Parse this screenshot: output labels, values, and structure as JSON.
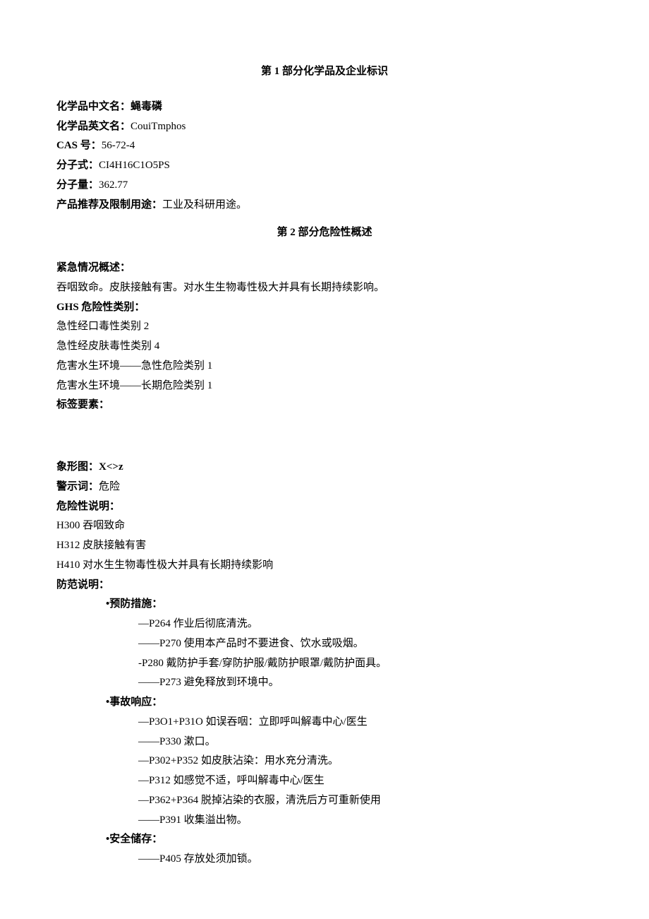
{
  "section1": {
    "title": "第 1 部分化学品及企业标识",
    "name_cn_label": "化学品中文名：",
    "name_cn_value": "蝇毒磷",
    "name_en_label": "化学品英文名：",
    "name_en_value": "CouiTmphos",
    "cas_label": "CAS 号：",
    "cas_value": "56-72-4",
    "formula_label": "分子式：",
    "formula_value": "CI4H16C1O5PS",
    "mw_label": "分子量：",
    "mw_value": "362.77",
    "use_label": "产品推荐及限制用途：",
    "use_value": "工业及科研用途。"
  },
  "section2": {
    "title": "第 2 部分危险性概述",
    "emergency_label": "紧急情况概述：",
    "emergency_value": "吞咽致命。皮肤接触有害。对水生生物毒性极大并具有长期持续影响。",
    "ghs_label": "GHS 危险性类别：",
    "ghs_items": [
      "急性经口毒性类别 2",
      "急性经皮肤毒性类别 4",
      "危害水生环境——急性危险类别 1",
      "危害水生环境——长期危险类别 1"
    ],
    "label_elements": "标签要素：",
    "pictogram_label": "象形图：",
    "pictogram_value": "X<>z",
    "signal_label": "警示词：",
    "signal_value": "危险",
    "hazard_label": "危险性说明：",
    "hazard_items": [
      "H300 吞咽致命",
      "H312 皮肤接触有害",
      "H410 对水生生物毒性极大并具有长期持续影响"
    ],
    "precaution_label": "防范说明：",
    "prevention_label": "•预防措施：",
    "prevention_items": [
      "—P264 作业后彻底清洗。",
      "——P270 使用本产品时不要进食、饮水或吸烟。",
      "-P280 戴防护手套/穿防护服/戴防护眼罩/戴防护面具。",
      "——P273 避免释放到环境中。"
    ],
    "response_label": "•事故响应：",
    "response_items": [
      "—P3O1+P31O 如误吞咽：立即呼叫解毒中心/医生",
      "——P330 漱口。",
      "—P302+P352 如皮肤沾染：用水充分清洗。",
      "—P312 如感觉不适，呼叫解毒中心/医生",
      "—P362+P364 脱掉沾染的衣服，清洗后方可重新使用",
      "——P391 收集溢出物。"
    ],
    "storage_label": "•安全储存：",
    "storage_items": [
      "——P405 存放处须加锁。"
    ]
  }
}
